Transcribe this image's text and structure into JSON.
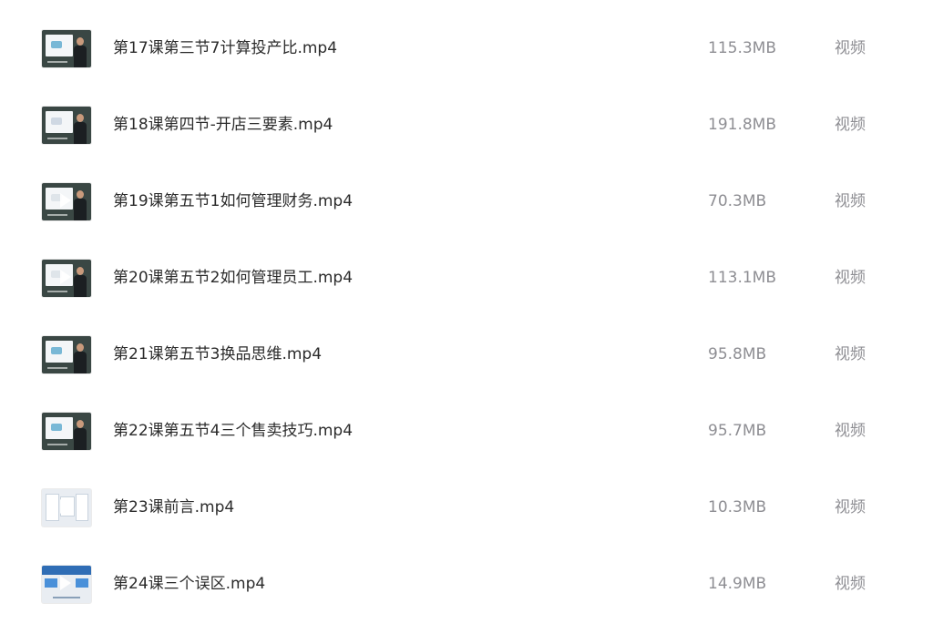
{
  "files": [
    {
      "name": "第17课第三节7计算投产比.mp4",
      "size": "115.3MB",
      "type": "视频",
      "thumbnail_icon": "video-thumbnail-icon"
    },
    {
      "name": "第18课第四节-开店三要素.mp4",
      "size": "191.8MB",
      "type": "视频",
      "thumbnail_icon": "video-thumbnail-icon"
    },
    {
      "name": "第19课第五节1如何管理财务.mp4",
      "size": "70.3MB",
      "type": "视频",
      "thumbnail_icon": "video-thumbnail-icon"
    },
    {
      "name": "第20课第五节2如何管理员工.mp4",
      "size": "113.1MB",
      "type": "视频",
      "thumbnail_icon": "video-thumbnail-icon"
    },
    {
      "name": "第21课第五节3换品思维.mp4",
      "size": "95.8MB",
      "type": "视频",
      "thumbnail_icon": "video-thumbnail-icon"
    },
    {
      "name": "第22课第五节4三个售卖技巧.mp4",
      "size": "95.7MB",
      "type": "视频",
      "thumbnail_icon": "video-thumbnail-icon"
    },
    {
      "name": "第23课前言.mp4",
      "size": "10.3MB",
      "type": "视频",
      "thumbnail_icon": "video-thumbnail-icon"
    },
    {
      "name": "第24课三个误区.mp4",
      "size": "14.9MB",
      "type": "视频",
      "thumbnail_icon": "video-thumbnail-icon"
    }
  ],
  "colors": {
    "filename_text": "#2b2b2b",
    "meta_text": "#8e8e93",
    "background": "#ffffff"
  }
}
